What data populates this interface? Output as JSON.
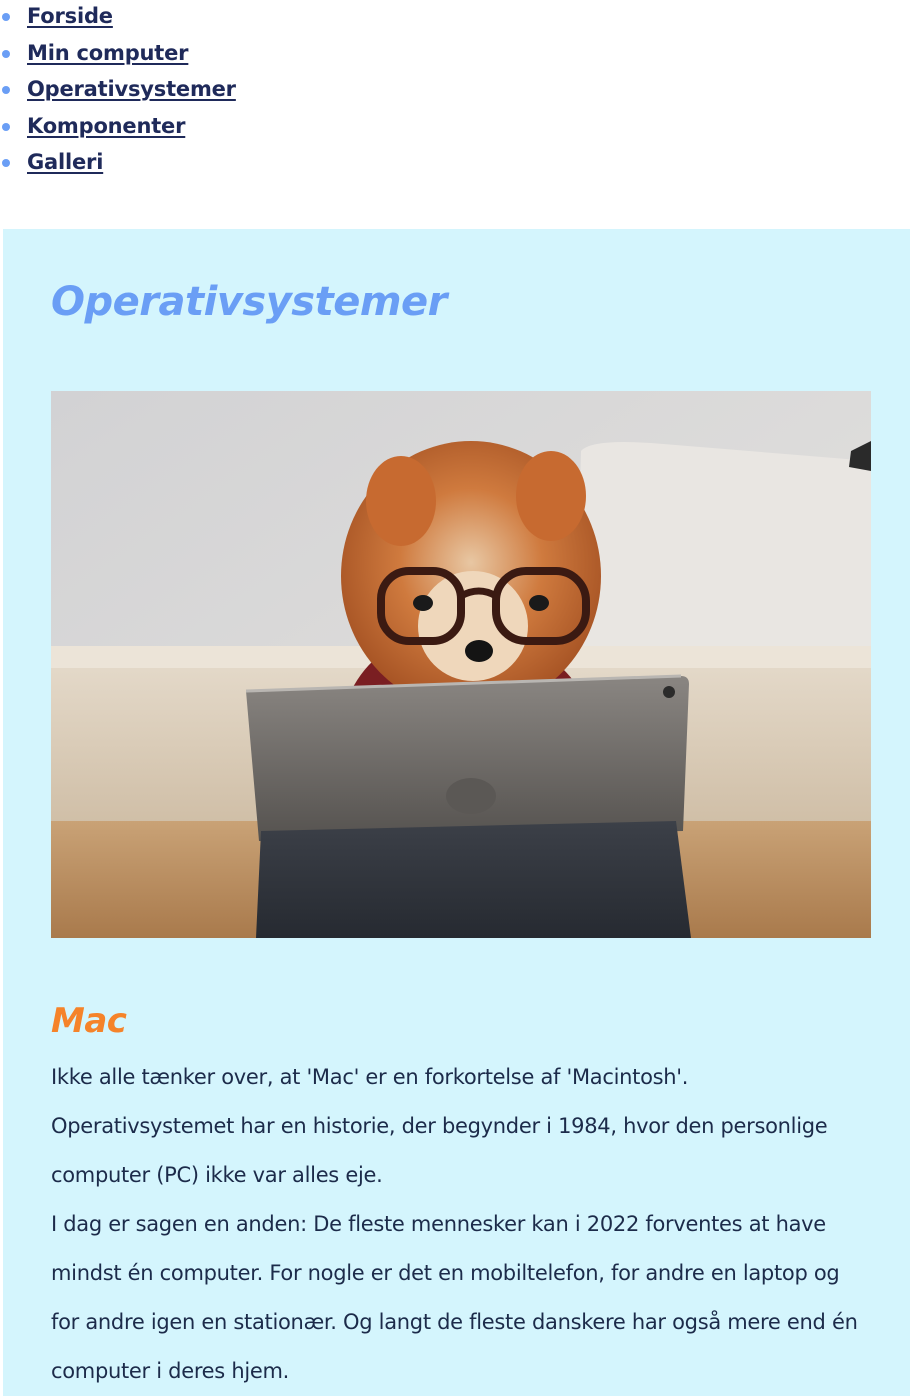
{
  "nav": {
    "items": [
      {
        "label": "Forside"
      },
      {
        "label": "Min computer"
      },
      {
        "label": "Operativsystemer"
      },
      {
        "label": "Komponenter"
      },
      {
        "label": "Galleri"
      }
    ]
  },
  "main": {
    "title": "Operativsystemer",
    "hero_image": {
      "subject": "pomeranian-dog-with-glasses-using-tablet"
    },
    "section": {
      "title": "Mac",
      "lines": [
        "Ikke alle tænker over, at 'Mac' er en forkortelse af 'Macintosh'.",
        "Operativsystemet har en historie, der begynder i 1984, hvor den personlige",
        "computer (PC) ikke var alles eje.",
        "I dag er sagen en anden: De fleste mennesker kan i 2022 forventes at have",
        "mindst én computer. For nogle er det en mobiltelefon, for andre en laptop og",
        "for andre igen en stationær. Og langt de fleste danskere har også mere end én",
        "computer i deres hjem."
      ]
    }
  },
  "colors": {
    "link": "#1f2a5a",
    "bullet": "#6a9ef5",
    "main_background": "#d4f5fd",
    "page_title": "#6a9ef5",
    "section_title": "#f5832a",
    "body_text": "#1c2b4a"
  }
}
